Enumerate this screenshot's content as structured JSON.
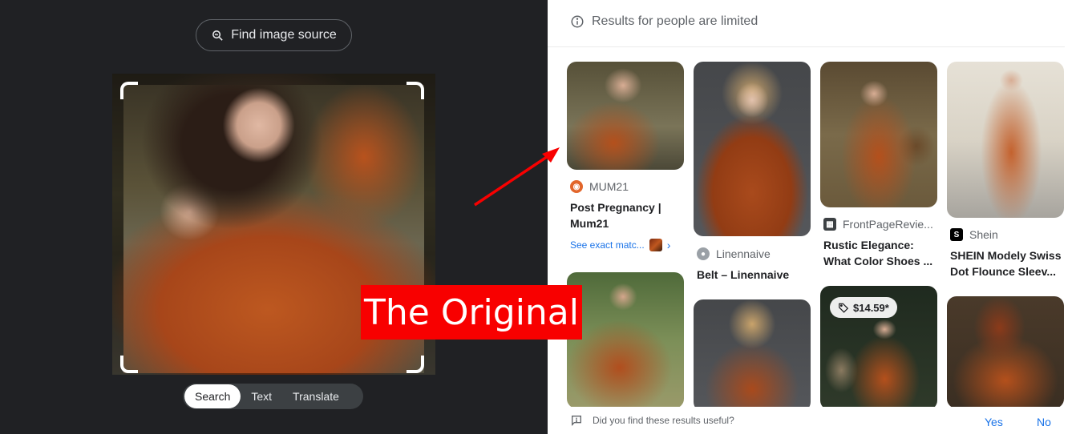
{
  "left_panel": {
    "find_source_label": "Find image source",
    "modes": [
      "Search",
      "Text",
      "Translate"
    ],
    "active_mode": "Search"
  },
  "results": {
    "notice": "Results for people are limited",
    "items": [
      {
        "source": "MUM21",
        "title": "Post Pregnancy | Mum21",
        "exact_match": "See exact matc..."
      },
      {
        "source": "Linennaive",
        "title": "Belt – Linennaive"
      },
      {
        "source": "FrontPageRevie...",
        "title": "Rustic Elegance: What Color Shoes ..."
      },
      {
        "source": "Shein",
        "title": "SHEIN Modely Swiss Dot Flounce Sleev..."
      }
    ],
    "price_badge": "$14.59*"
  },
  "feedback": {
    "question": "Did you find these results useful?",
    "yes": "Yes",
    "no": "No"
  },
  "annotation": {
    "label": "The Original",
    "color": "#f80000"
  },
  "colors": {
    "dark_bg": "#202124",
    "accent_blue": "#1a73e8"
  }
}
